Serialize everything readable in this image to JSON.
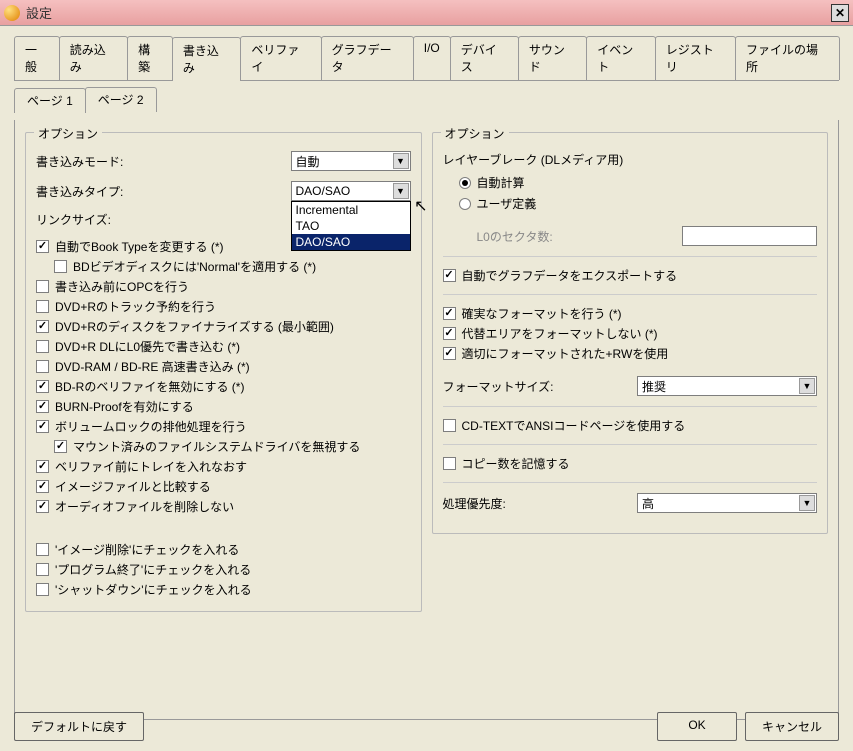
{
  "window": {
    "title": "設定"
  },
  "tabs": [
    "一般",
    "読み込み",
    "構築",
    "書き込み",
    "ベリファイ",
    "グラフデータ",
    "I/O",
    "デバイス",
    "サウンド",
    "イベント",
    "レジストリ",
    "ファイルの場所"
  ],
  "subtabs": [
    "ページ 1",
    "ページ 2"
  ],
  "left": {
    "group_title": "オプション",
    "write_mode_label": "書き込みモード:",
    "write_mode_value": "自動",
    "write_type_label": "書き込みタイプ:",
    "write_type_value": "DAO/SAO",
    "write_type_options": [
      "Incremental",
      "TAO",
      "DAO/SAO"
    ],
    "link_size_label": "リンクサイズ:",
    "checks": {
      "c1": "自動でBook Typeを変更する (*)",
      "c1a": "BDビデオディスクには'Normal'を適用する (*)",
      "c2": "書き込み前にOPCを行う",
      "c3": "DVD+Rのトラック予約を行う",
      "c4": "DVD+Rのディスクをファイナライズする (最小範囲)",
      "c5": "DVD+R DLにL0優先で書き込む (*)",
      "c6": "DVD-RAM / BD-RE 高速書き込み (*)",
      "c7": "BD-Rのベリファイを無効にする (*)",
      "c8": "BURN-Proofを有効にする",
      "c9": "ボリュームロックの排他処理を行う",
      "c9a": "マウント済みのファイルシステムドライバを無視する",
      "c10": "ベリファイ前にトレイを入れなおす",
      "c11": "イメージファイルと比較する",
      "c12": "オーディオファイルを削除しない",
      "c13": "'イメージ削除'にチェックを入れる",
      "c14": "'プログラム終了'にチェックを入れる",
      "c15": "'シャットダウン'にチェックを入れる"
    }
  },
  "right": {
    "group_title": "オプション",
    "layer_break_label": "レイヤーブレーク (DLメディア用)",
    "radio_auto": "自動計算",
    "radio_user": "ユーザ定義",
    "l0_label": "L0のセクタ数:",
    "export_graph": "自動でグラフデータをエクスポートする",
    "proper_format": "確実なフォーマットを行う (*)",
    "no_spare": "代替エリアをフォーマットしない (*)",
    "use_rw": "適切にフォーマットされた+RWを使用",
    "format_size_label": "フォーマットサイズ:",
    "format_size_value": "推奨",
    "cd_text": "CD-TEXTでANSIコードページを使用する",
    "remember_copies": "コピー数を記憶する",
    "priority_label": "処理優先度:",
    "priority_value": "高"
  },
  "buttons": {
    "defaults": "デフォルトに戻す",
    "ok": "OK",
    "cancel": "キャンセル"
  }
}
